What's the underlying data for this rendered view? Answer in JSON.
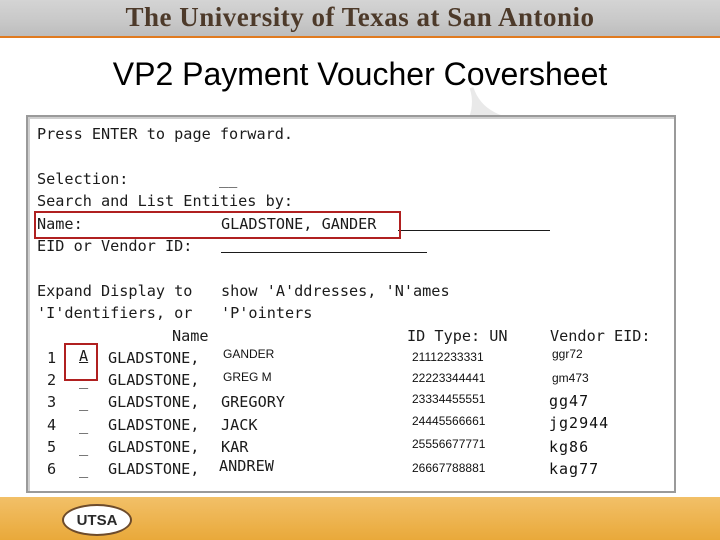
{
  "banner": {
    "title": "The University of Texas at San Antonio"
  },
  "slide": {
    "title": "VP2 Payment Voucher Coversheet"
  },
  "terminal": {
    "line_press_enter": "Press ENTER to page forward.",
    "selection_label": "Selection:",
    "selection_value": "__",
    "search_header": "Search and List Entities by:",
    "name_label": "Name:",
    "name_value": "GLADSTONE, GANDER",
    "eid_label": "EID or Vendor ID:",
    "expand_line1_a": "Expand Display to",
    "expand_line1_b": "show 'A'ddresses, 'N'ames",
    "expand_line2_a": "'I'dentifiers, or",
    "expand_line2_b": "'P'ointers",
    "col_name": "Name",
    "col_idtype": "ID Type: UN",
    "col_vendor": "Vendor EID:",
    "rows": [
      {
        "num": "1",
        "sel": "A",
        "last": "GLADSTONE,",
        "first": "GANDER",
        "id": "21112233331",
        "vendor": "ggr72"
      },
      {
        "num": "2",
        "sel": "_",
        "last": "GLADSTONE,",
        "first": "GREG M",
        "id": "22223344441",
        "vendor": "gm473"
      },
      {
        "num": "3",
        "sel": "_",
        "last": "GLADSTONE,",
        "first": "GREGORY",
        "id": "23334455551",
        "vendor": "gg47"
      },
      {
        "num": "4",
        "sel": "_",
        "last": "GLADSTONE,",
        "first": "JACK",
        "id": "24445566661",
        "vendor": "jg2944"
      },
      {
        "num": "5",
        "sel": "_",
        "last": "GLADSTONE,",
        "first": "KAR",
        "id": "25556677771",
        "vendor": "kg86"
      },
      {
        "num": "6",
        "sel": "_",
        "last": "GLADSTONE,",
        "first": "ANDREW",
        "id": "26667788881",
        "vendor": "kag77"
      }
    ]
  },
  "footer": {
    "logo_text": "UTSA"
  },
  "colors": {
    "accent": "#e07a1f",
    "highlight_box": "#b02020",
    "footer": "#e9a93a"
  }
}
